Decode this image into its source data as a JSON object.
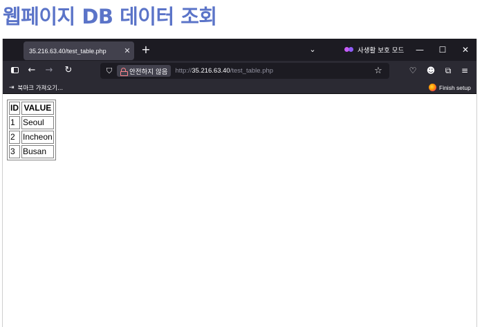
{
  "heading": "웹페이지 DB 데이터 조회",
  "tab": {
    "title": "35.216.63.40/test_table.php",
    "close": "✕"
  },
  "tabstrip": {
    "new_tab": "+",
    "list_all_tabs": "⌄",
    "private_label": "사생활 보호 모드",
    "minimize": "—",
    "maximize": "☐",
    "close": "✕"
  },
  "nav": {
    "sidebar": "",
    "back": "←",
    "forward": "→",
    "reload": "↻"
  },
  "urlbar": {
    "shield": "⛉",
    "insecure_label": "안전하지 않음",
    "scheme": "http://",
    "host": "35.216.63.40",
    "path": "/test_table.php",
    "star": "☆"
  },
  "toolbar": {
    "pocket": "♡",
    "account": "☻",
    "extensions": "⧉",
    "menu": "≡"
  },
  "bookmarks": {
    "import_icon": "⇥",
    "import_label": "북마크 가져오기...",
    "finish_label": "Finish setup"
  },
  "table": {
    "headers": [
      "ID",
      "VALUE"
    ],
    "rows": [
      [
        "1",
        "Seoul"
      ],
      [
        "2",
        "Incheon"
      ],
      [
        "3",
        "Busan"
      ]
    ]
  },
  "colors": {
    "heading": "#5B74C8",
    "tabstrip_bg": "#1c1b22",
    "toolbar_bg": "#2b2a33"
  }
}
